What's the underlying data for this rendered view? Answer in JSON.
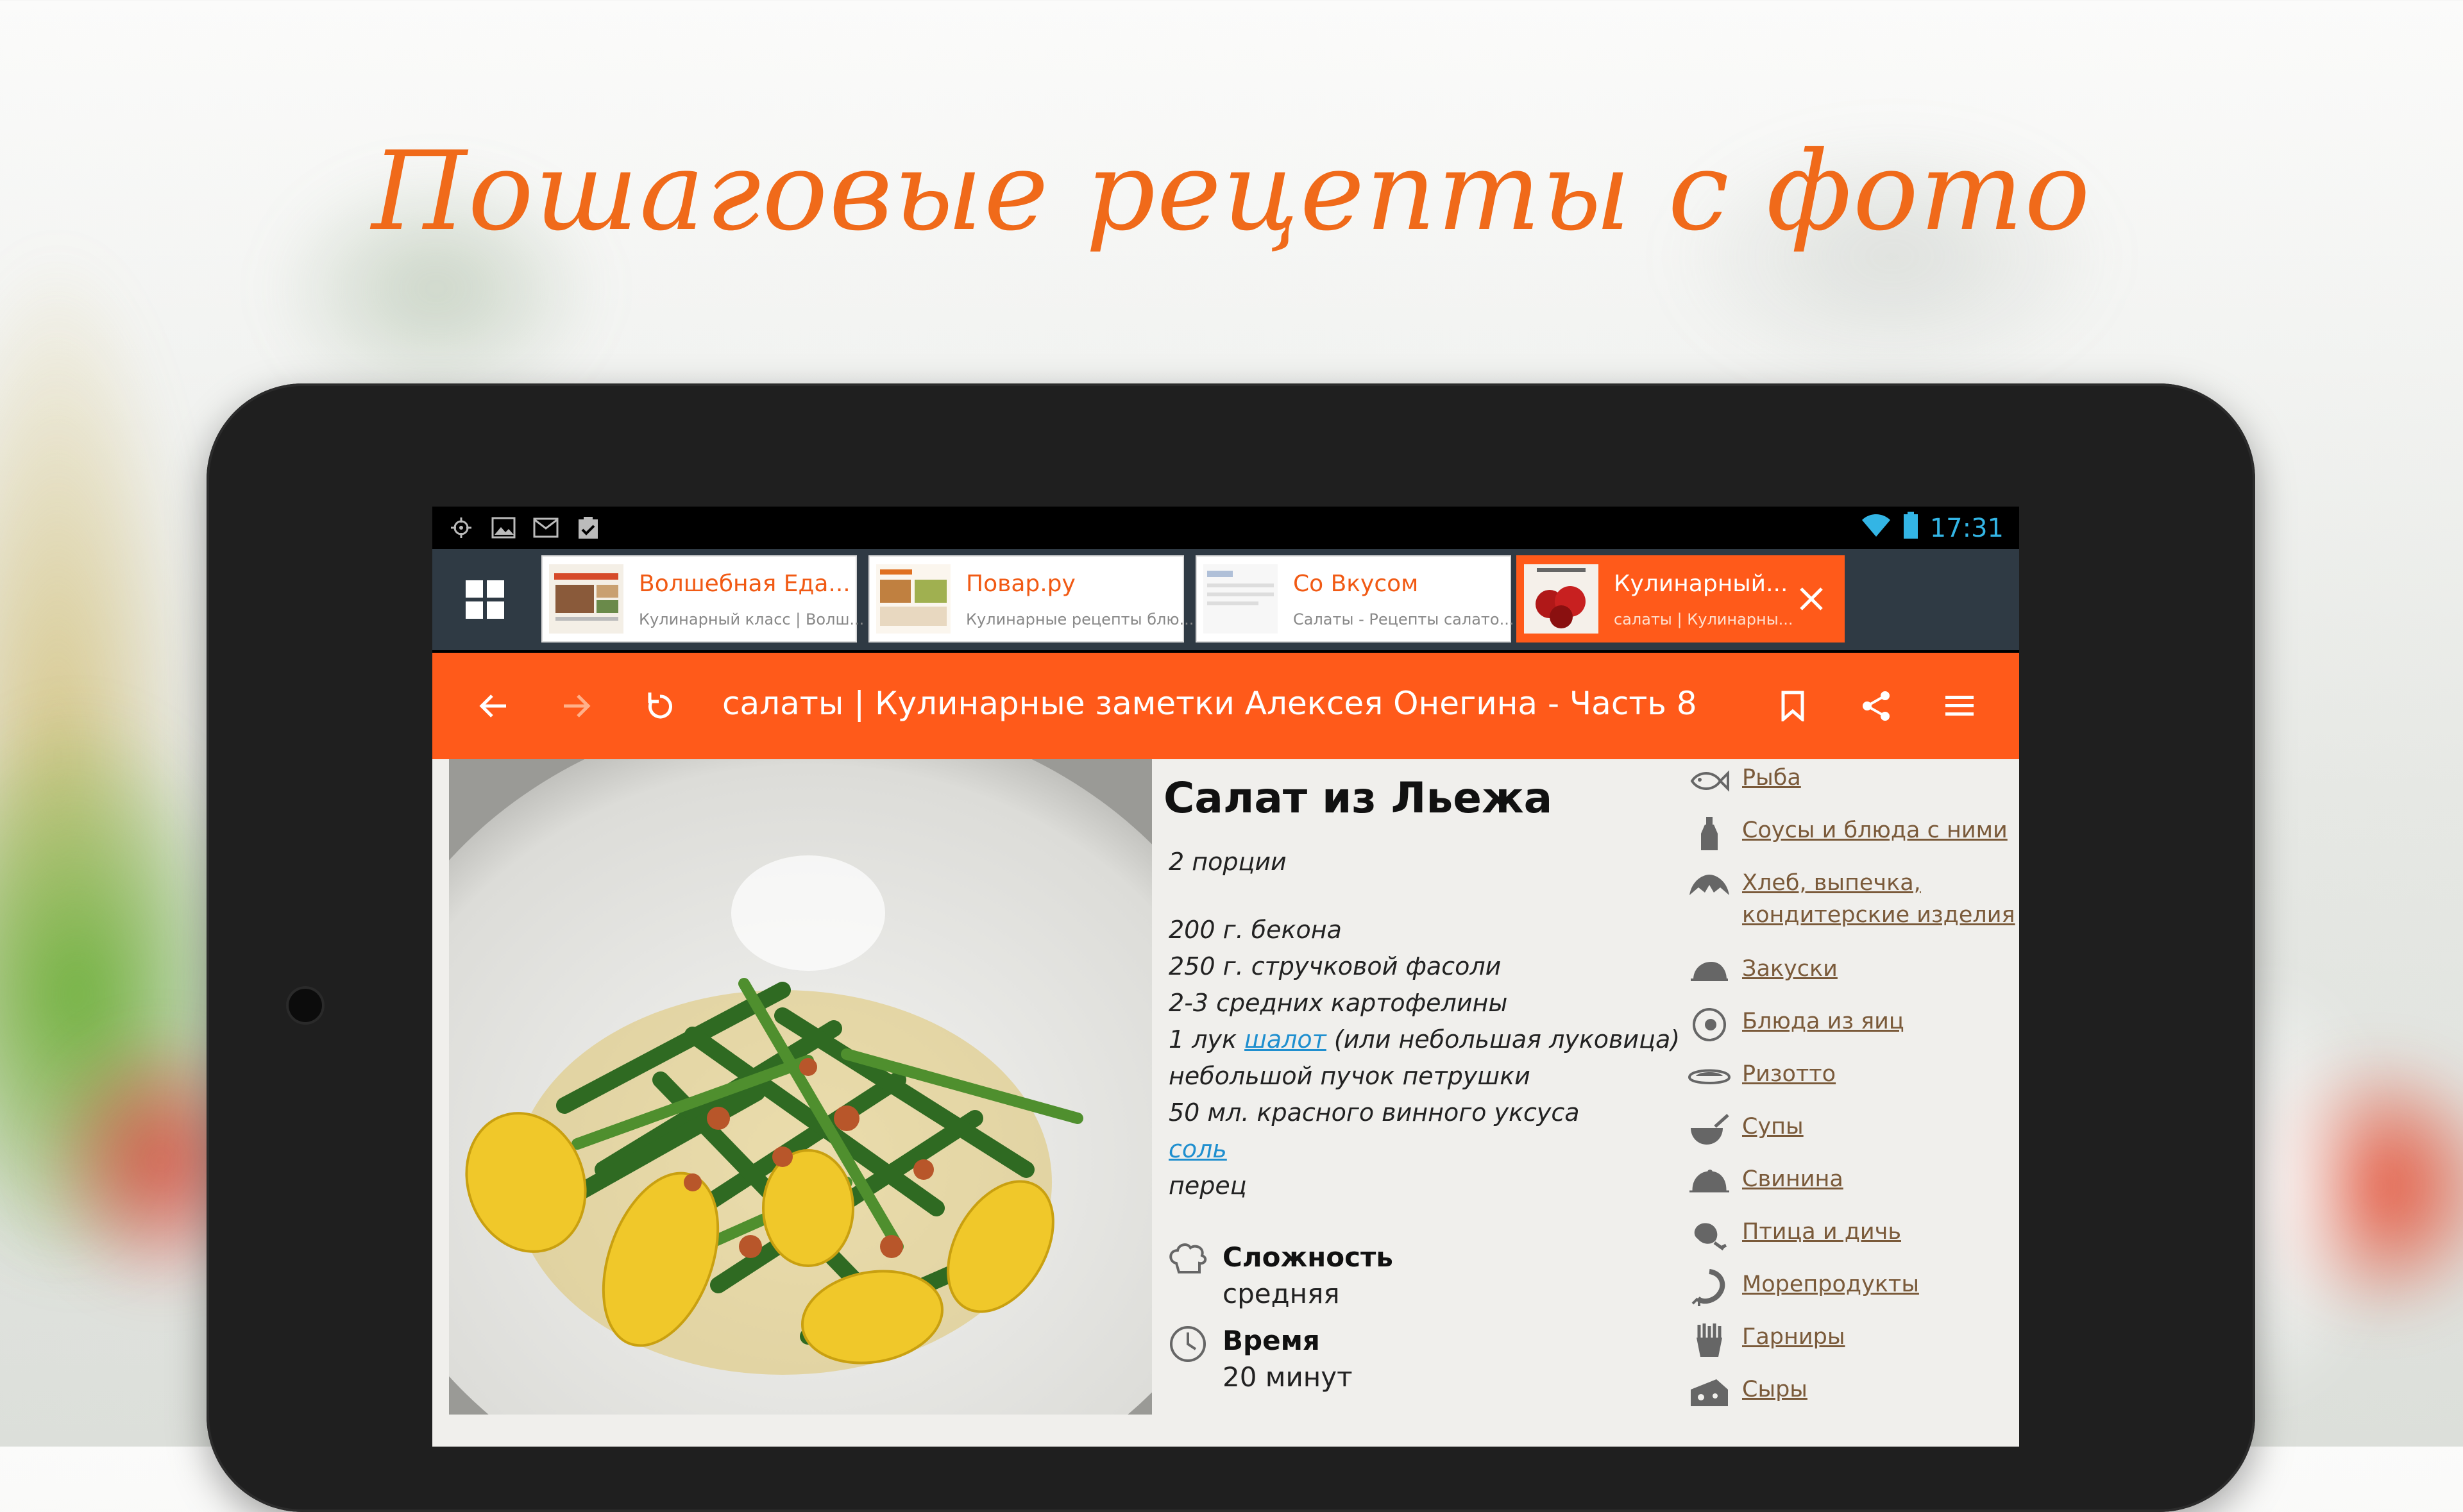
{
  "headline": "Пошаговые рецепты с фото",
  "status_bar": {
    "time": "17:31",
    "icons_left": [
      "gps-icon",
      "image-icon",
      "gmail-icon",
      "clipboard-check-icon"
    ],
    "icons_right": [
      "wifi-icon",
      "battery-icon"
    ]
  },
  "tabs": [
    {
      "title": "Волшебная Еда...",
      "subtitle": "Кулинарный класс | Волш..."
    },
    {
      "title": "Повар.ру",
      "subtitle": "Кулинарные рецепты блю..."
    },
    {
      "title": "Со Вкусом",
      "subtitle": "Салаты - Рецепты салато..."
    },
    {
      "title": "Кулинарный...",
      "subtitle": "салаты | Кулинарны...",
      "active": true
    }
  ],
  "toolbar": {
    "title": "салаты | Кулинарные заметки Алексея Онегина - Часть 8"
  },
  "recipe": {
    "title": "Салат из Льежа",
    "portions": "2 порции",
    "ingredients": {
      "i1": "200 г. бекона",
      "i2": "250 г. стручковой фасоли",
      "i3": "2-3 средних картофелины",
      "i4_pre": "1 лук ",
      "i4_link": "шалот",
      "i4_post": " (или небольшая луковица)",
      "i5": "небольшой пучок петрушки",
      "i6": "50 мл. красного винного уксуса",
      "i7_link": "соль",
      "i8": "перец"
    },
    "difficulty_label": "Сложность",
    "difficulty_value": "средняя",
    "time_label": "Время",
    "time_value": "20 минут"
  },
  "categories": [
    {
      "label": "Рыба",
      "icon": "fish-icon"
    },
    {
      "label": "Соусы и блюда с ними",
      "icon": "sauce-bottle-icon"
    },
    {
      "label": "Хлеб, выпечка,",
      "label2": "кондитерские изделия",
      "icon": "croissant-icon"
    },
    {
      "label": "Закуски",
      "icon": "appetizer-icon"
    },
    {
      "label": "Блюда из яиц",
      "icon": "egg-icon"
    },
    {
      "label": "Ризотто",
      "icon": "risotto-icon"
    },
    {
      "label": "Супы",
      "icon": "soup-icon"
    },
    {
      "label": "Свинина",
      "icon": "pork-icon"
    },
    {
      "label": "Птица и дичь",
      "icon": "poultry-icon"
    },
    {
      "label": "Морепродукты",
      "icon": "shrimp-icon"
    },
    {
      "label": "Гарниры",
      "icon": "fries-icon"
    },
    {
      "label": "Сыры",
      "icon": "cheese-icon"
    }
  ],
  "colors": {
    "accent": "#ff5a1a",
    "headline": "#f06a1a",
    "tab_bar": "#2f3a44",
    "link": "#1f8fcf",
    "category_link": "#7a5a3a"
  }
}
